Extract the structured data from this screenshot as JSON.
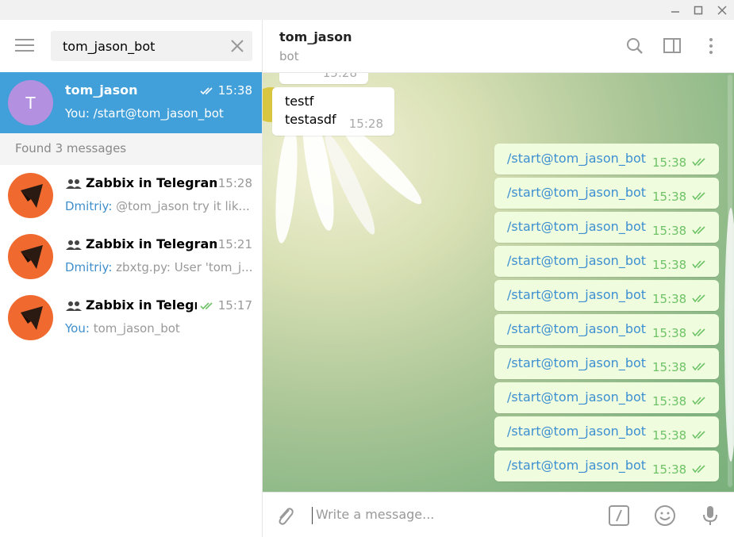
{
  "window": {
    "buttons": [
      "minimize",
      "maximize",
      "close"
    ]
  },
  "sidebar": {
    "search": {
      "value": "tom_jason_bot",
      "placeholder": ""
    },
    "active_dialog": {
      "avatar_letter": "T",
      "title": "tom_jason",
      "time": "15:38",
      "preview": "You: /start@tom_jason_bot"
    },
    "found_label": "Found 3 messages",
    "results": [
      {
        "title": "Zabbix in Telegram ...",
        "time": "15:28",
        "sender": "Dmitriy:",
        "text": "@tom_jason   try it lik..."
      },
      {
        "title": "Zabbix in Telegram ...",
        "time": "15:21",
        "sender": "Dmitriy:",
        "text": "zbxtg.py: User 'tom_j..."
      },
      {
        "title": "Zabbix in Telegr...",
        "time": "15:17",
        "sender": "You:",
        "text": "tom_jason_bot"
      }
    ]
  },
  "chat": {
    "peer_name": "tom_jason",
    "peer_status": "bot",
    "partial_time": "15:28",
    "incoming": {
      "line1": "testf",
      "line2": "testasdf",
      "time": "15:28"
    },
    "outgoing": [
      {
        "text": "/start@tom_jason_bot",
        "time": "15:38"
      },
      {
        "text": "/start@tom_jason_bot",
        "time": "15:38"
      },
      {
        "text": "/start@tom_jason_bot",
        "time": "15:38"
      },
      {
        "text": "/start@tom_jason_bot",
        "time": "15:38"
      },
      {
        "text": "/start@tom_jason_bot",
        "time": "15:38"
      },
      {
        "text": "/start@tom_jason_bot",
        "time": "15:38"
      },
      {
        "text": "/start@tom_jason_bot",
        "time": "15:38"
      },
      {
        "text": "/start@tom_jason_bot",
        "time": "15:38"
      },
      {
        "text": "/start@tom_jason_bot",
        "time": "15:38"
      },
      {
        "text": "/start@tom_jason_bot",
        "time": "15:38"
      }
    ],
    "composer_placeholder": "Write a message...",
    "colors": {
      "accent": "#419fd9",
      "outgoing_bubble": "#effdde",
      "outgoing_text": "#3d8fd1",
      "read_check": "#6ec267"
    }
  },
  "icons": [
    "menu-icon",
    "clear-icon",
    "double-check-icon",
    "group-icon",
    "paper-plane-icon",
    "search-icon",
    "sidebar-toggle-icon",
    "more-icon",
    "attach-icon",
    "bot-command-icon",
    "emoji-icon",
    "microphone-icon"
  ]
}
